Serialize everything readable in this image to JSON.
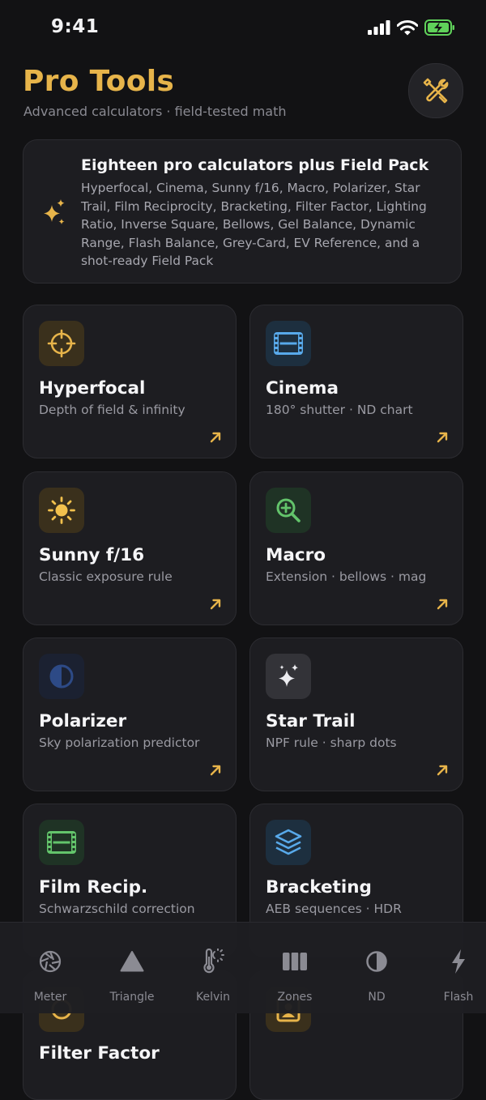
{
  "status": {
    "time": "9:41"
  },
  "header": {
    "title": "Pro Tools",
    "subtitle": "Advanced calculators · field-tested math"
  },
  "banner": {
    "title": "Eighteen pro calculators plus Field Pack",
    "body": "Hyperfocal, Cinema, Sunny f/16, Macro, Polarizer, Star Trail, Film Reciprocity, Bracketing, Filter Factor, Lighting Ratio, Inverse Square, Bellows, Gel Balance, Dynamic Range, Flash Balance, Grey-Card, EV Reference, and a shot-ready Field Pack"
  },
  "cards": [
    {
      "title": "Hyperfocal",
      "subtitle": "Depth of field & infinity",
      "icon": "crosshair-icon"
    },
    {
      "title": "Cinema",
      "subtitle": "180° shutter · ND chart",
      "icon": "film-icon"
    },
    {
      "title": "Sunny f/16",
      "subtitle": "Classic exposure rule",
      "icon": "sun-icon"
    },
    {
      "title": "Macro",
      "subtitle": "Extension · bellows · mag",
      "icon": "magnify-plus-icon"
    },
    {
      "title": "Polarizer",
      "subtitle": "Sky polarization predictor",
      "icon": "half-circle-icon"
    },
    {
      "title": "Star Trail",
      "subtitle": "NPF rule · sharp dots",
      "icon": "sparkles-icon"
    },
    {
      "title": "Film Recip.",
      "subtitle": "Schwarzschild correction",
      "icon": "film-strip-icon"
    },
    {
      "title": "Bracketing",
      "subtitle": "AEB sequences · HDR",
      "icon": "layers-icon"
    }
  ],
  "peek": {
    "title": "Filter Factor"
  },
  "tabs": [
    {
      "label": "Meter",
      "icon": "aperture-icon"
    },
    {
      "label": "Triangle",
      "icon": "triangle-icon"
    },
    {
      "label": "Kelvin",
      "icon": "thermometer-sun-icon"
    },
    {
      "label": "Zones",
      "icon": "zones-icon"
    },
    {
      "label": "ND",
      "icon": "half-circle-icon"
    },
    {
      "label": "Flash",
      "icon": "bolt-icon"
    }
  ],
  "colors": {
    "accent": "#e7b44a",
    "background": "#121214",
    "card": "#1d1d21"
  }
}
